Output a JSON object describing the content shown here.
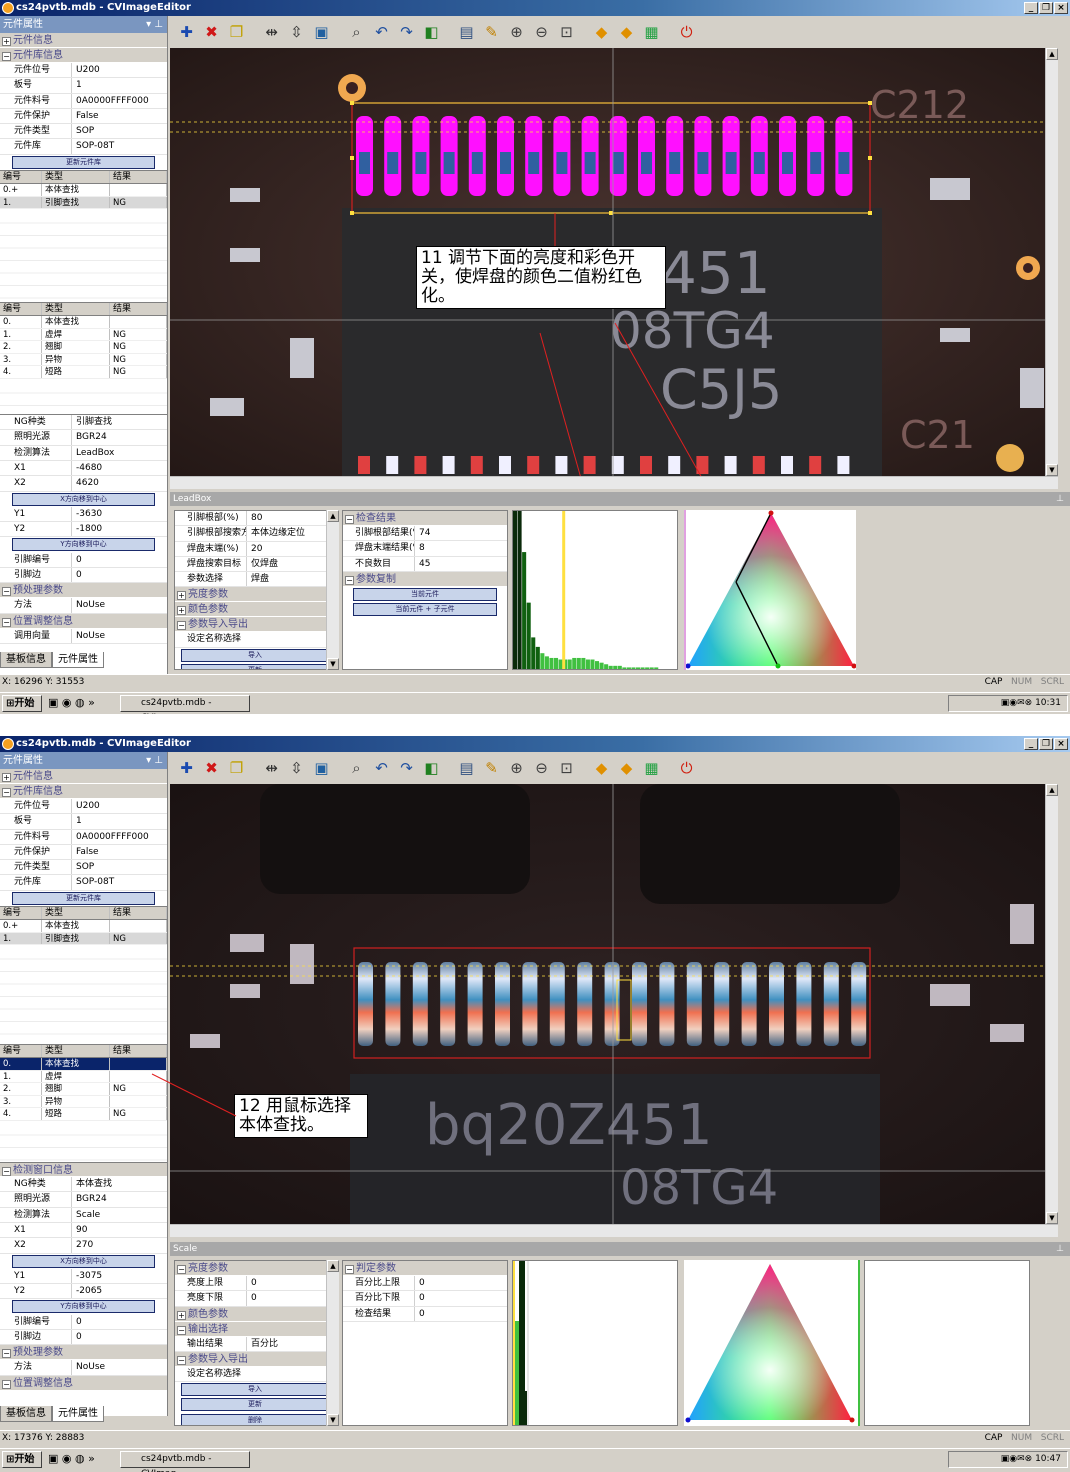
{
  "window": {
    "title": "cs24pvtb.mdb - CVImageEditor",
    "panel_title": "元件属性",
    "controls": [
      "_",
      "❐",
      "×"
    ]
  },
  "toolbar": {
    "icons": [
      "add-icon",
      "delete-icon",
      "copy-icon",
      "align-h-icon",
      "align-v-icon",
      "fit-icon",
      "zoom-icon",
      "rotate-left-icon",
      "rotate-right-icon",
      "layer-icon",
      "save-icon",
      "open-icon",
      "zoom-in-icon",
      "zoom-out-icon",
      "zoom-fit-icon",
      "prev-icon",
      "next-icon",
      "export-icon",
      "power-icon"
    ],
    "glyphs": [
      "✚",
      "✖",
      "❐",
      "⇹",
      "⇳",
      "▣",
      "⌕",
      "↶",
      "↷",
      "◧",
      "▤",
      "✎",
      "⊕",
      "⊖",
      "⊡",
      "◆",
      "◆",
      "▦",
      "⏻"
    ]
  },
  "screen1": {
    "sections": {
      "component_info": "元件信息",
      "library_info": "元件库信息"
    },
    "library_rows": [
      {
        "k": "元件位号",
        "v": "U200"
      },
      {
        "k": "板号",
        "v": "1"
      },
      {
        "k": "元件料号",
        "v": "0A0000FFFF000"
      },
      {
        "k": "元件保护",
        "v": "False"
      },
      {
        "k": "元件类型",
        "v": "SOP"
      },
      {
        "k": "元件库",
        "v": "SOP-08T"
      }
    ],
    "update_btn": "更新元件库",
    "grid1": {
      "headers": [
        "编号",
        "类型",
        "结果"
      ],
      "rows": [
        [
          "0.+",
          "本体查找",
          ""
        ],
        [
          "1.",
          "引脚查找",
          "NG"
        ]
      ]
    },
    "grid2": {
      "headers": [
        "编号",
        "类型",
        "结果"
      ],
      "rows": [
        [
          "0.",
          "本体查找",
          ""
        ],
        [
          "1.",
          "虚焊",
          "NG"
        ],
        [
          "2.",
          "翘脚",
          "NG"
        ],
        [
          "3.",
          "异物",
          "NG"
        ],
        [
          "4.",
          "短路",
          "NG"
        ]
      ]
    },
    "detect_rows": [
      {
        "k": "NG种类",
        "v": "引脚查找"
      },
      {
        "k": "照明光源",
        "v": "BGR24"
      },
      {
        "k": "检测算法",
        "v": "LeadBox"
      },
      {
        "k": "X1",
        "v": "-4680"
      },
      {
        "k": "X2",
        "v": "4620"
      }
    ],
    "x_center_btn": "X方向移到中心",
    "detect_rows_y": [
      {
        "k": "Y1",
        "v": "-3630"
      },
      {
        "k": "Y2",
        "v": "-1800"
      }
    ],
    "y_center_btn": "Y方向移到中心",
    "detect_rows_tail": [
      {
        "k": "引脚编号",
        "v": "0"
      },
      {
        "k": "引脚边",
        "v": "0"
      }
    ],
    "pre_section": "预处理参数",
    "method": {
      "k": "方法",
      "v": "NoUse"
    },
    "pos_section": "位置调整信息",
    "adjust": {
      "k": "调用向量",
      "v": "NoUse"
    },
    "tabs": [
      "基板信息",
      "元件属性"
    ],
    "hint": "11 调节下面的亮度和彩色开关，使焊盘的颜色二值粉红色化。",
    "chip_text": [
      "451",
      "08TG4",
      "C5J5"
    ],
    "board_text": [
      "C212",
      "C21"
    ],
    "bottom_title": "LeadBox",
    "params": [
      {
        "k": "引脚根部(%)",
        "v": "80"
      },
      {
        "k": "引脚根部搜索方",
        "v": "本体边缘定位"
      },
      {
        "k": "焊盘末端(%)",
        "v": "20"
      },
      {
        "k": "焊盘搜索目标",
        "v": "仅焊盘"
      },
      {
        "k": "参数选择",
        "v": "焊盘"
      }
    ],
    "param_sections": [
      "亮度参数",
      "颜色参数",
      "参数导入导出"
    ],
    "name_select": "设定名称选择",
    "import_btn": "导入",
    "update2_btn": "更新",
    "result_section": "检查结果",
    "results": [
      {
        "k": "引脚根部结果(%)",
        "v": "74"
      },
      {
        "k": "焊盘末端结果(%)",
        "v": "8"
      },
      {
        "k": "不良数目",
        "v": "45"
      }
    ],
    "copy_section": "参数复制",
    "copy_btn1": "当前元件",
    "copy_btn2": "当前元件 + 子元件",
    "histogram": {
      "bars": [
        1.0,
        1.0,
        0.74,
        0.42,
        0.2,
        0.14,
        0.1,
        0.08,
        0.07,
        0.07,
        0.06,
        0.06,
        0.06,
        0.07,
        0.07,
        0.07,
        0.06,
        0.06,
        0.05,
        0.04,
        0.03,
        0.02,
        0.02,
        0.02,
        0.01,
        0.01,
        0.01,
        0.01,
        0.01,
        0.01,
        0.01,
        0.01,
        0.0,
        0.0,
        0.0,
        0.0
      ],
      "threshold": 0.3
    },
    "status_xy": "X: 16296 Y: 31553",
    "status_flags": [
      "CAP",
      "NUM",
      "SCRL"
    ],
    "taskbar": {
      "start": "开始",
      "task": "cs24pvtb.mdb - CVImag...",
      "time": "10:31"
    }
  },
  "screen2": {
    "library_rows": [
      {
        "k": "元件位号",
        "v": "U200"
      },
      {
        "k": "板号",
        "v": "1"
      },
      {
        "k": "元件料号",
        "v": "0A0000FFFF000"
      },
      {
        "k": "元件保护",
        "v": "False"
      },
      {
        "k": "元件类型",
        "v": "SOP"
      },
      {
        "k": "元件库",
        "v": "SOP-08T"
      }
    ],
    "grid2": {
      "headers": [
        "编号",
        "类型",
        "结果"
      ],
      "rows": [
        [
          "0.",
          "本体查找",
          ""
        ],
        [
          "1.",
          "虚焊",
          ""
        ],
        [
          "2.",
          "翘脚",
          "NG"
        ],
        [
          "3.",
          "异物",
          ""
        ],
        [
          "4.",
          "短路",
          "NG"
        ]
      ]
    },
    "window_section": "检测窗口信息",
    "detect_rows": [
      {
        "k": "NG种类",
        "v": "本体查找"
      },
      {
        "k": "照明光源",
        "v": "BGR24"
      },
      {
        "k": "检测算法",
        "v": "Scale"
      },
      {
        "k": "X1",
        "v": "90"
      },
      {
        "k": "X2",
        "v": "270"
      }
    ],
    "detect_rows_y": [
      {
        "k": "Y1",
        "v": "-3075"
      },
      {
        "k": "Y2",
        "v": "-2065"
      }
    ],
    "detect_rows_tail": [
      {
        "k": "引脚编号",
        "v": "0"
      },
      {
        "k": "引脚边",
        "v": "0"
      }
    ],
    "hint": "12 用鼠标选择本体查找。",
    "chip_text": [
      "bq20Z451",
      "08TG4"
    ],
    "bottom_title": "Scale",
    "brightness_section": "亮度参数",
    "params": [
      {
        "k": "亮度上限",
        "v": "0"
      },
      {
        "k": "亮度下限",
        "v": "0"
      }
    ],
    "color_section": "颜色参数",
    "output_section": "输出选择",
    "output": {
      "k": "输出结果",
      "v": "百分比"
    },
    "io_section": "参数导入导出",
    "update3_btn": "删除",
    "judge_section": "判定参数",
    "results": [
      {
        "k": "百分比上限",
        "v": "0"
      },
      {
        "k": "百分比下限",
        "v": "0"
      },
      {
        "k": "检查结果",
        "v": "0"
      }
    ],
    "status_xy": "X: 17376 Y: 28883",
    "taskbar": {
      "start": "开始",
      "task": "cs24pvtb.mdb - CVImag...",
      "time": "10:47"
    }
  }
}
